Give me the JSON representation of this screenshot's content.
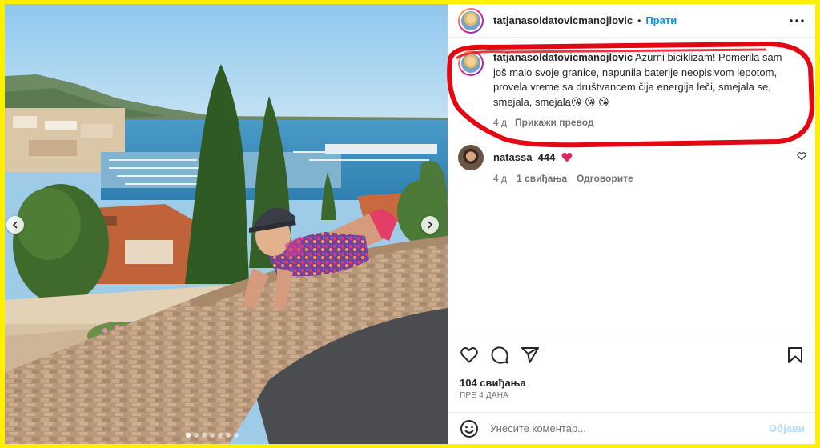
{
  "post": {
    "author": "tatjanasoldatovicmanojlovic",
    "separator": "•",
    "follow_label": "Прати",
    "caption_author": "tatjanasoldatovicmanojlovic",
    "caption": "Azurni biciklizam! Pomerila sam još malo svoje granice, napunila baterije neopisivom lepotom, provela vreme sa društvancem čija energija leči, smejala se, smejala, smejala😘 😘 😘",
    "caption_age": "4 д",
    "translate_label": "Прикажи превод"
  },
  "comments": [
    {
      "user": "natassa_444",
      "age": "4 д",
      "likes": "1 свиђања",
      "reply_label": "Одговорите"
    }
  ],
  "actions": {
    "like_icon": "heart-icon",
    "comment_icon": "comment-icon",
    "share_icon": "share-icon",
    "save_icon": "bookmark-icon"
  },
  "stats": {
    "likes": "104 свиђања",
    "time": "ПРЕ 4 ДАНА"
  },
  "composer": {
    "placeholder": "Унесите коментар...",
    "post_label": "Објави"
  },
  "carousel": {
    "slide_count": 7,
    "active_index": 0
  },
  "colors": {
    "border": "#ffef00",
    "link": "#0095f6",
    "annotation": "#e30613",
    "heart": "#ed4956"
  }
}
